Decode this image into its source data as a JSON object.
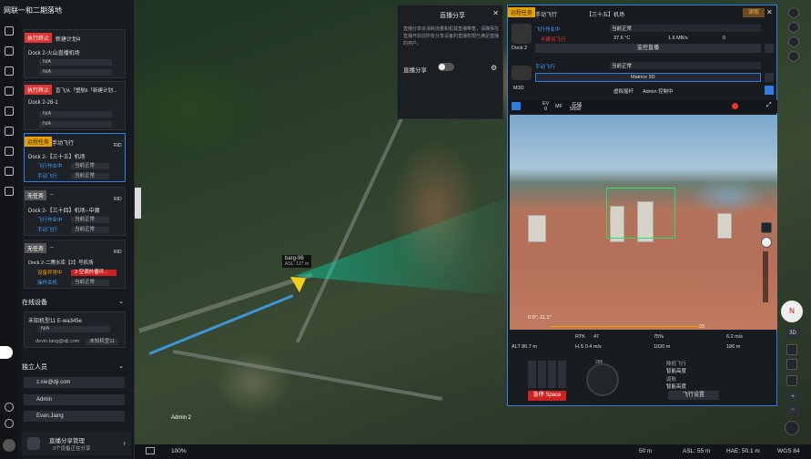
{
  "app": {
    "title": "网联一和二期落地"
  },
  "tasks": [
    {
      "status_tag": "执行终止",
      "name": "新建计划4",
      "device": "Dock 2-火山直播机场",
      "value1": "N/A",
      "value2": "N/A",
      "status": "当前正常"
    },
    {
      "status_tag": "执行终止",
      "name": "直飞从「塑航li「新建计划...",
      "device": "Dock 2-26-1",
      "value1": "N/A",
      "value2": "N/A",
      "status": "当前正常"
    },
    {
      "status_tag": "远程任务",
      "name": "手动飞行",
      "badge": "RID",
      "device": "Dock 2-【三十五】机场",
      "field1": "飞行作业中",
      "value1": "当前正常",
      "field2": "手动飞行",
      "value2": "当前正常"
    },
    {
      "status_tag": "无任务",
      "name": "--",
      "badge": "RID",
      "device": "Dock 2-【三十四】机场--中庸",
      "field1": "飞行作业中",
      "value1": "当前正常",
      "field2": "手动飞行",
      "value2": "当前正常"
    },
    {
      "status_tag": "无任务",
      "name": "--",
      "badge": "RID",
      "device": "Dock 2-二腾水库【2】号机场",
      "field1": "设备异常中",
      "value1": "3 空调外循环...",
      "field2": "操作关机",
      "value2": "当前正常"
    }
  ],
  "online": {
    "title": "在线设备",
    "device": "未知机型11 E-wa345e",
    "value": "N/A",
    "user": "devin.tang@dji.com",
    "badge": "未知机型11"
  },
  "people": {
    "title": "独立人员",
    "items": [
      "z.xie@dji.com",
      "Admin",
      "Evan.Jiang"
    ]
  },
  "live_mgmt": {
    "title": "直播分享管理",
    "sub": "3个设备正在分享"
  },
  "share": {
    "title": "直播分享",
    "desc": "直播分享会消耗流量和机载直播带宽，请确保在直播开启前所有分享设备的直播权限已满足直播的用户。",
    "toggle_label": "直播分享"
  },
  "panel": {
    "tag": "远程任务",
    "mode": "手动飞行",
    "dock": "【三十五】机场",
    "report_btn": "读取",
    "dock_label": "Dock 2",
    "drone_label": "M3D",
    "status1": "飞行作业中",
    "status1_val": "当前正常",
    "weather": "不建议飞行",
    "temp": "37.6 °C",
    "speed": "1.6 MB/s",
    "count": "0",
    "live_btn": "监控直播",
    "status2": "手动飞行",
    "status2_val": "当前正常",
    "model": "Matrice 3D",
    "stick": "虚拟摇杆",
    "control": "Admin 控制中",
    "cam_ev": "EV",
    "cam_ev_val": "0",
    "cam_mf": "MF",
    "storage": "存储",
    "storage_val": "5858",
    "gimbal": "0.0°,-11.1°",
    "zoom": "2X",
    "rtk": "RTK",
    "rtk_val": "47",
    "battery": "75%",
    "speed_v": "6.2 m/s",
    "alt": "ALT 86.7 m",
    "hs": "H.S 0.4 m/s",
    "dist": "1020 m",
    "dist2": "186 m",
    "emergency": "急停 Space",
    "mode1": "降低飞行",
    "mode1_val": "智能高度",
    "mode2": "返航",
    "mode2_val": "智能高度",
    "fly_settings": "飞行设置",
    "compass": "285"
  },
  "map": {
    "drone_label": "barg-96",
    "drone_sub": "ASL: 127 m",
    "admin_label": "Admin 2",
    "view": "3D"
  },
  "bottom": {
    "zoom": "100%",
    "scale": "50 m",
    "asl": "ASL: 55 m",
    "hae": "HAE: 50.1 m",
    "wgs": "WGS 84"
  }
}
